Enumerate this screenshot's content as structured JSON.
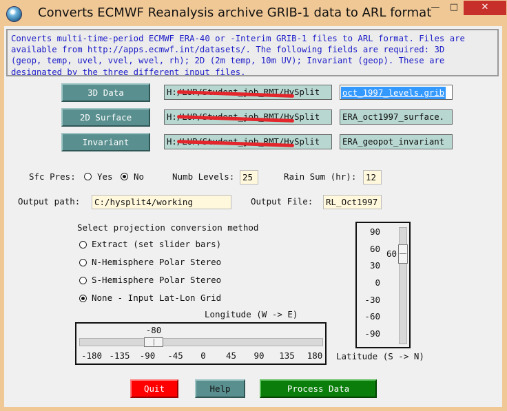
{
  "window": {
    "title": "Converts ECMWF Reanalysis archive GRIB-1 data to ARL format",
    "minimize_label": "—",
    "maximize_label": "□",
    "close_label": "✕"
  },
  "description": "Converts multi-time-period ECMWF ERA-40 or -Interim GRIB-1 files to ARL format. Files are\navailable from http://apps.ecmwf.int/datasets/. The following fields are required: 3D\n(geop, temp, uvel, vvel, wvel, rh); 2D (2m temp, 10m UV); Invariant (geop). These are\ndesignated by the three different input files.",
  "inputs": [
    {
      "button": "3D Data",
      "dir": "H:/LUP/Student_job_RMT/HySplit",
      "file": "oct_1997_levels.grib",
      "selected": true
    },
    {
      "button": "2D Surface",
      "dir": "H:/LUP/Student_job_RMT/HySplit",
      "file": "ERA_oct1997_surface.",
      "selected": false
    },
    {
      "button": "Invariant",
      "dir": "H:/LUP/Student_job_RMT/HySplit",
      "file": "ERA_geopot_invariant",
      "selected": false
    }
  ],
  "options": {
    "sfc_pres_label": "Sfc Pres:",
    "yes_label": "Yes",
    "no_label": "No",
    "sfc_pres_value": "No",
    "numb_levels_label": "Numb Levels:",
    "numb_levels": "25",
    "rain_sum_label": "Rain Sum (hr):",
    "rain_sum": "12",
    "output_path_label": "Output path:",
    "output_path": "C:/hysplit4/working",
    "output_file_label": "Output File:",
    "output_file": "RL_Oct1997"
  },
  "projection": {
    "heading": "Select projection conversion method",
    "methods": [
      "Extract (set slider bars)",
      "N-Hemisphere Polar Stereo",
      "S-Hemisphere Polar Stereo",
      "None - Input Lat-Lon Grid"
    ],
    "selected_index": 3
  },
  "longitude": {
    "label": "Longitude (W -> E)",
    "value": "-80",
    "min": -180,
    "max": 180,
    "ticks": [
      "-180",
      "-135",
      "-90",
      "-45",
      "0",
      "45",
      "90",
      "135",
      "180"
    ]
  },
  "latitude": {
    "label": "Latitude (S -> N)",
    "value": "60",
    "min": -90,
    "max": 90,
    "ticks": [
      "90",
      "60",
      "30",
      "0",
      "-30",
      "-60",
      "-90"
    ]
  },
  "buttons": {
    "quit": "Quit",
    "help": "Help",
    "process": "Process Data"
  },
  "colors": {
    "description_text": "#1c1cc9",
    "quit": "#ff0000",
    "help": "#5a8f8f",
    "process": "#0b7d0b",
    "file_selected": "#3399ff"
  }
}
